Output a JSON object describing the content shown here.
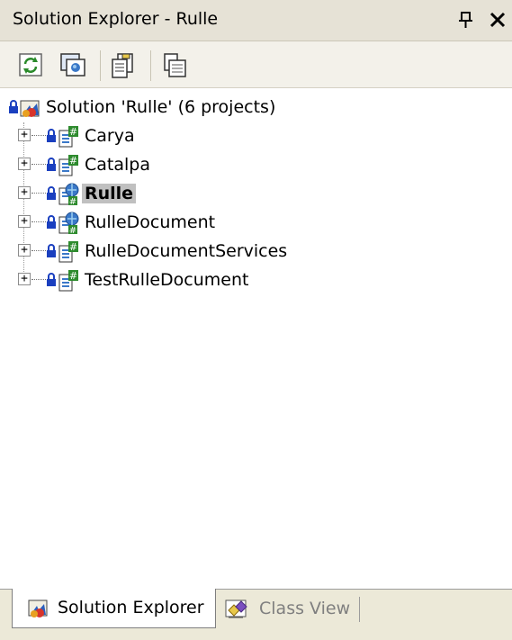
{
  "window": {
    "title": "Solution Explorer - Rulle",
    "pin_icon": "pushpin-icon",
    "close_icon": "close-icon"
  },
  "toolbar": {
    "buttons": [
      {
        "name": "refresh-button",
        "icon": "refresh-icon"
      },
      {
        "name": "show-all-files-button",
        "icon": "show-all-files-icon"
      },
      {
        "name": "properties-button",
        "icon": "properties-icon"
      },
      {
        "name": "view-code-button",
        "icon": "view-code-icon"
      }
    ]
  },
  "tree": {
    "root": {
      "label": "Solution 'Rulle' (6 projects)",
      "icon": "solution-icon"
    },
    "projects": [
      {
        "label": "Carya",
        "icon": "csharp-project-icon",
        "selected": false
      },
      {
        "label": "Catalpa",
        "icon": "csharp-project-icon",
        "selected": false
      },
      {
        "label": "Rulle",
        "icon": "web-project-icon",
        "selected": true
      },
      {
        "label": "RulleDocument",
        "icon": "web-project-icon",
        "selected": false
      },
      {
        "label": "RulleDocumentServices",
        "icon": "csharp-project-icon",
        "selected": false
      },
      {
        "label": "TestRulleDocument",
        "icon": "csharp-project-icon",
        "selected": false
      }
    ]
  },
  "tabs": [
    {
      "label": "Solution Explorer",
      "icon": "solution-explorer-icon",
      "active": true
    },
    {
      "label": "Class View",
      "icon": "class-view-icon",
      "active": false
    }
  ],
  "colors": {
    "title_bg": "#e6e2d6",
    "toolbar_bg": "#f3f1ea",
    "selection_bg": "#c0c0c0",
    "inactive_tab_text": "#7f7f7f",
    "lock_blue": "#1a3fbf"
  }
}
